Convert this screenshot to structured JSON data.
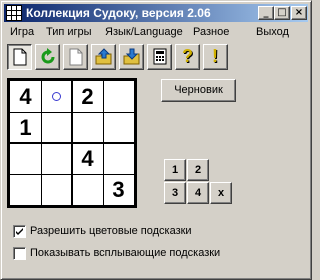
{
  "window": {
    "title": "Коллекция Судоку, версия 2.06",
    "minimize_glyph": "_",
    "maximize_glyph": "□",
    "close_glyph": "×"
  },
  "menu": {
    "items": [
      "Игра",
      "Тип игры",
      "Язык/Language",
      "Разное",
      "Выход"
    ]
  },
  "toolbar": {
    "buttons": [
      {
        "icon": "new-document-icon",
        "pressed": true
      },
      {
        "icon": "restart-icon",
        "pressed": false
      },
      {
        "icon": "blank-page-icon",
        "pressed": false
      },
      {
        "icon": "load-icon",
        "pressed": false
      },
      {
        "icon": "save-icon",
        "pressed": false
      },
      {
        "icon": "calculator-icon",
        "pressed": false
      },
      {
        "icon": "help-icon",
        "pressed": false
      },
      {
        "icon": "hint-icon",
        "pressed": false
      }
    ],
    "help_glyph": "?",
    "hint_glyph": "!"
  },
  "board": {
    "cells": [
      [
        "4",
        "",
        "2",
        ""
      ],
      [
        "1",
        "",
        "",
        ""
      ],
      [
        "",
        "",
        "4",
        ""
      ],
      [
        "",
        "",
        "",
        "3"
      ]
    ],
    "hint_marker_cell": [
      0,
      1
    ],
    "hint_color": "#3a3ad0"
  },
  "draft_button": "Черновик",
  "number_pad": {
    "row1": [
      "1",
      "2"
    ],
    "row2": [
      "3",
      "4",
      "x"
    ]
  },
  "options": {
    "color_hints": {
      "label": "Разрешить цветовые подсказки",
      "checked": true
    },
    "popup_hints": {
      "label": "Показывать всплывающие подсказки",
      "checked": false
    }
  },
  "colors": {
    "titlebar_start": "#0a246a",
    "titlebar_end": "#a6caf0",
    "face": "#d4d0c8"
  }
}
